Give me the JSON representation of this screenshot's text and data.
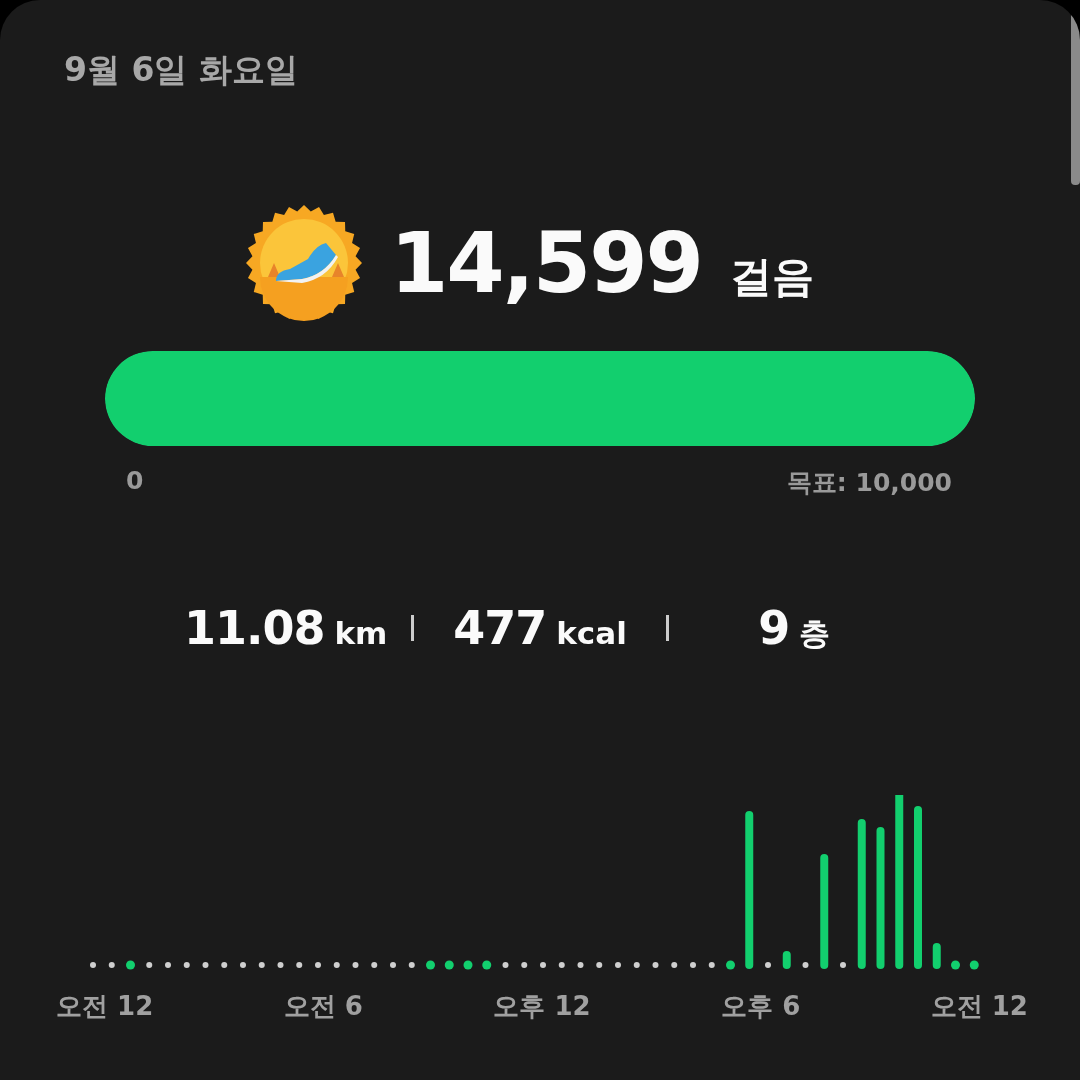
{
  "date": "9월 6일 화요일",
  "steps": {
    "count": "14,599",
    "unit": "걸음"
  },
  "goal_bar": {
    "level": 1,
    "min_label": "0",
    "goal_label": "목표: 10,000"
  },
  "stats": [
    {
      "value": "11.08",
      "unit": "km"
    },
    {
      "value": "477",
      "unit": "kcal"
    },
    {
      "value": "9",
      "unit": "층"
    }
  ],
  "activity_chart": {
    "x_labels": [
      "오전 12",
      "오전 6",
      "오후 12",
      "오후 6",
      "오전 12"
    ]
  }
}
